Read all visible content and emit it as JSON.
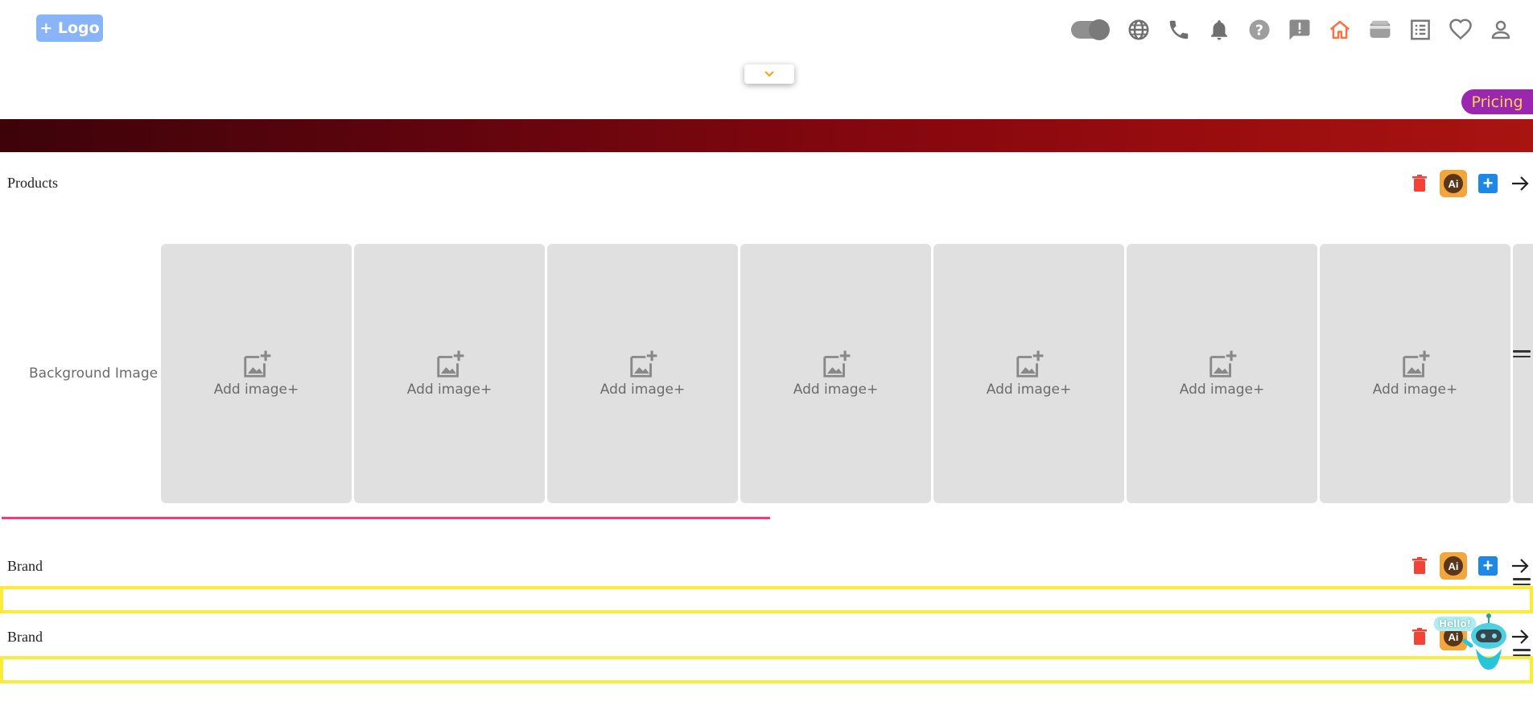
{
  "header": {
    "logo_label": "+ Logo",
    "toolbar_icons": [
      "toggle-switch",
      "globe-icon",
      "phone-icon",
      "bell-icon",
      "help-icon",
      "feedback-icon",
      "home-icon",
      "wallet-icon",
      "receipt-icon",
      "heart-icon",
      "user-icon"
    ],
    "active_icon": "home-icon",
    "accent_color": "#ff7043"
  },
  "dropdown": {
    "icon": "chevron-down-icon",
    "color": "#f5a623"
  },
  "pricing": {
    "label": "Pricing",
    "bg": "#9b27b0",
    "color": "#ffd54f"
  },
  "banner": {
    "gradient_start": "#3d0309",
    "gradient_end": "#a81410"
  },
  "products": {
    "title": "Products",
    "bg_label": "Background Image",
    "cards": [
      {
        "label": "Add image+"
      },
      {
        "label": "Add image+"
      },
      {
        "label": "Add image+"
      },
      {
        "label": "Add image+"
      },
      {
        "label": "Add image+"
      },
      {
        "label": "Add image+"
      },
      {
        "label": "Add image+"
      }
    ],
    "ai_label": "Ai"
  },
  "brand_sections": [
    {
      "title": "Brand",
      "ai_label": "Ai"
    },
    {
      "title": "Brand",
      "ai_label": "Ai"
    }
  ],
  "assistant": {
    "greeting": "Hello!"
  }
}
